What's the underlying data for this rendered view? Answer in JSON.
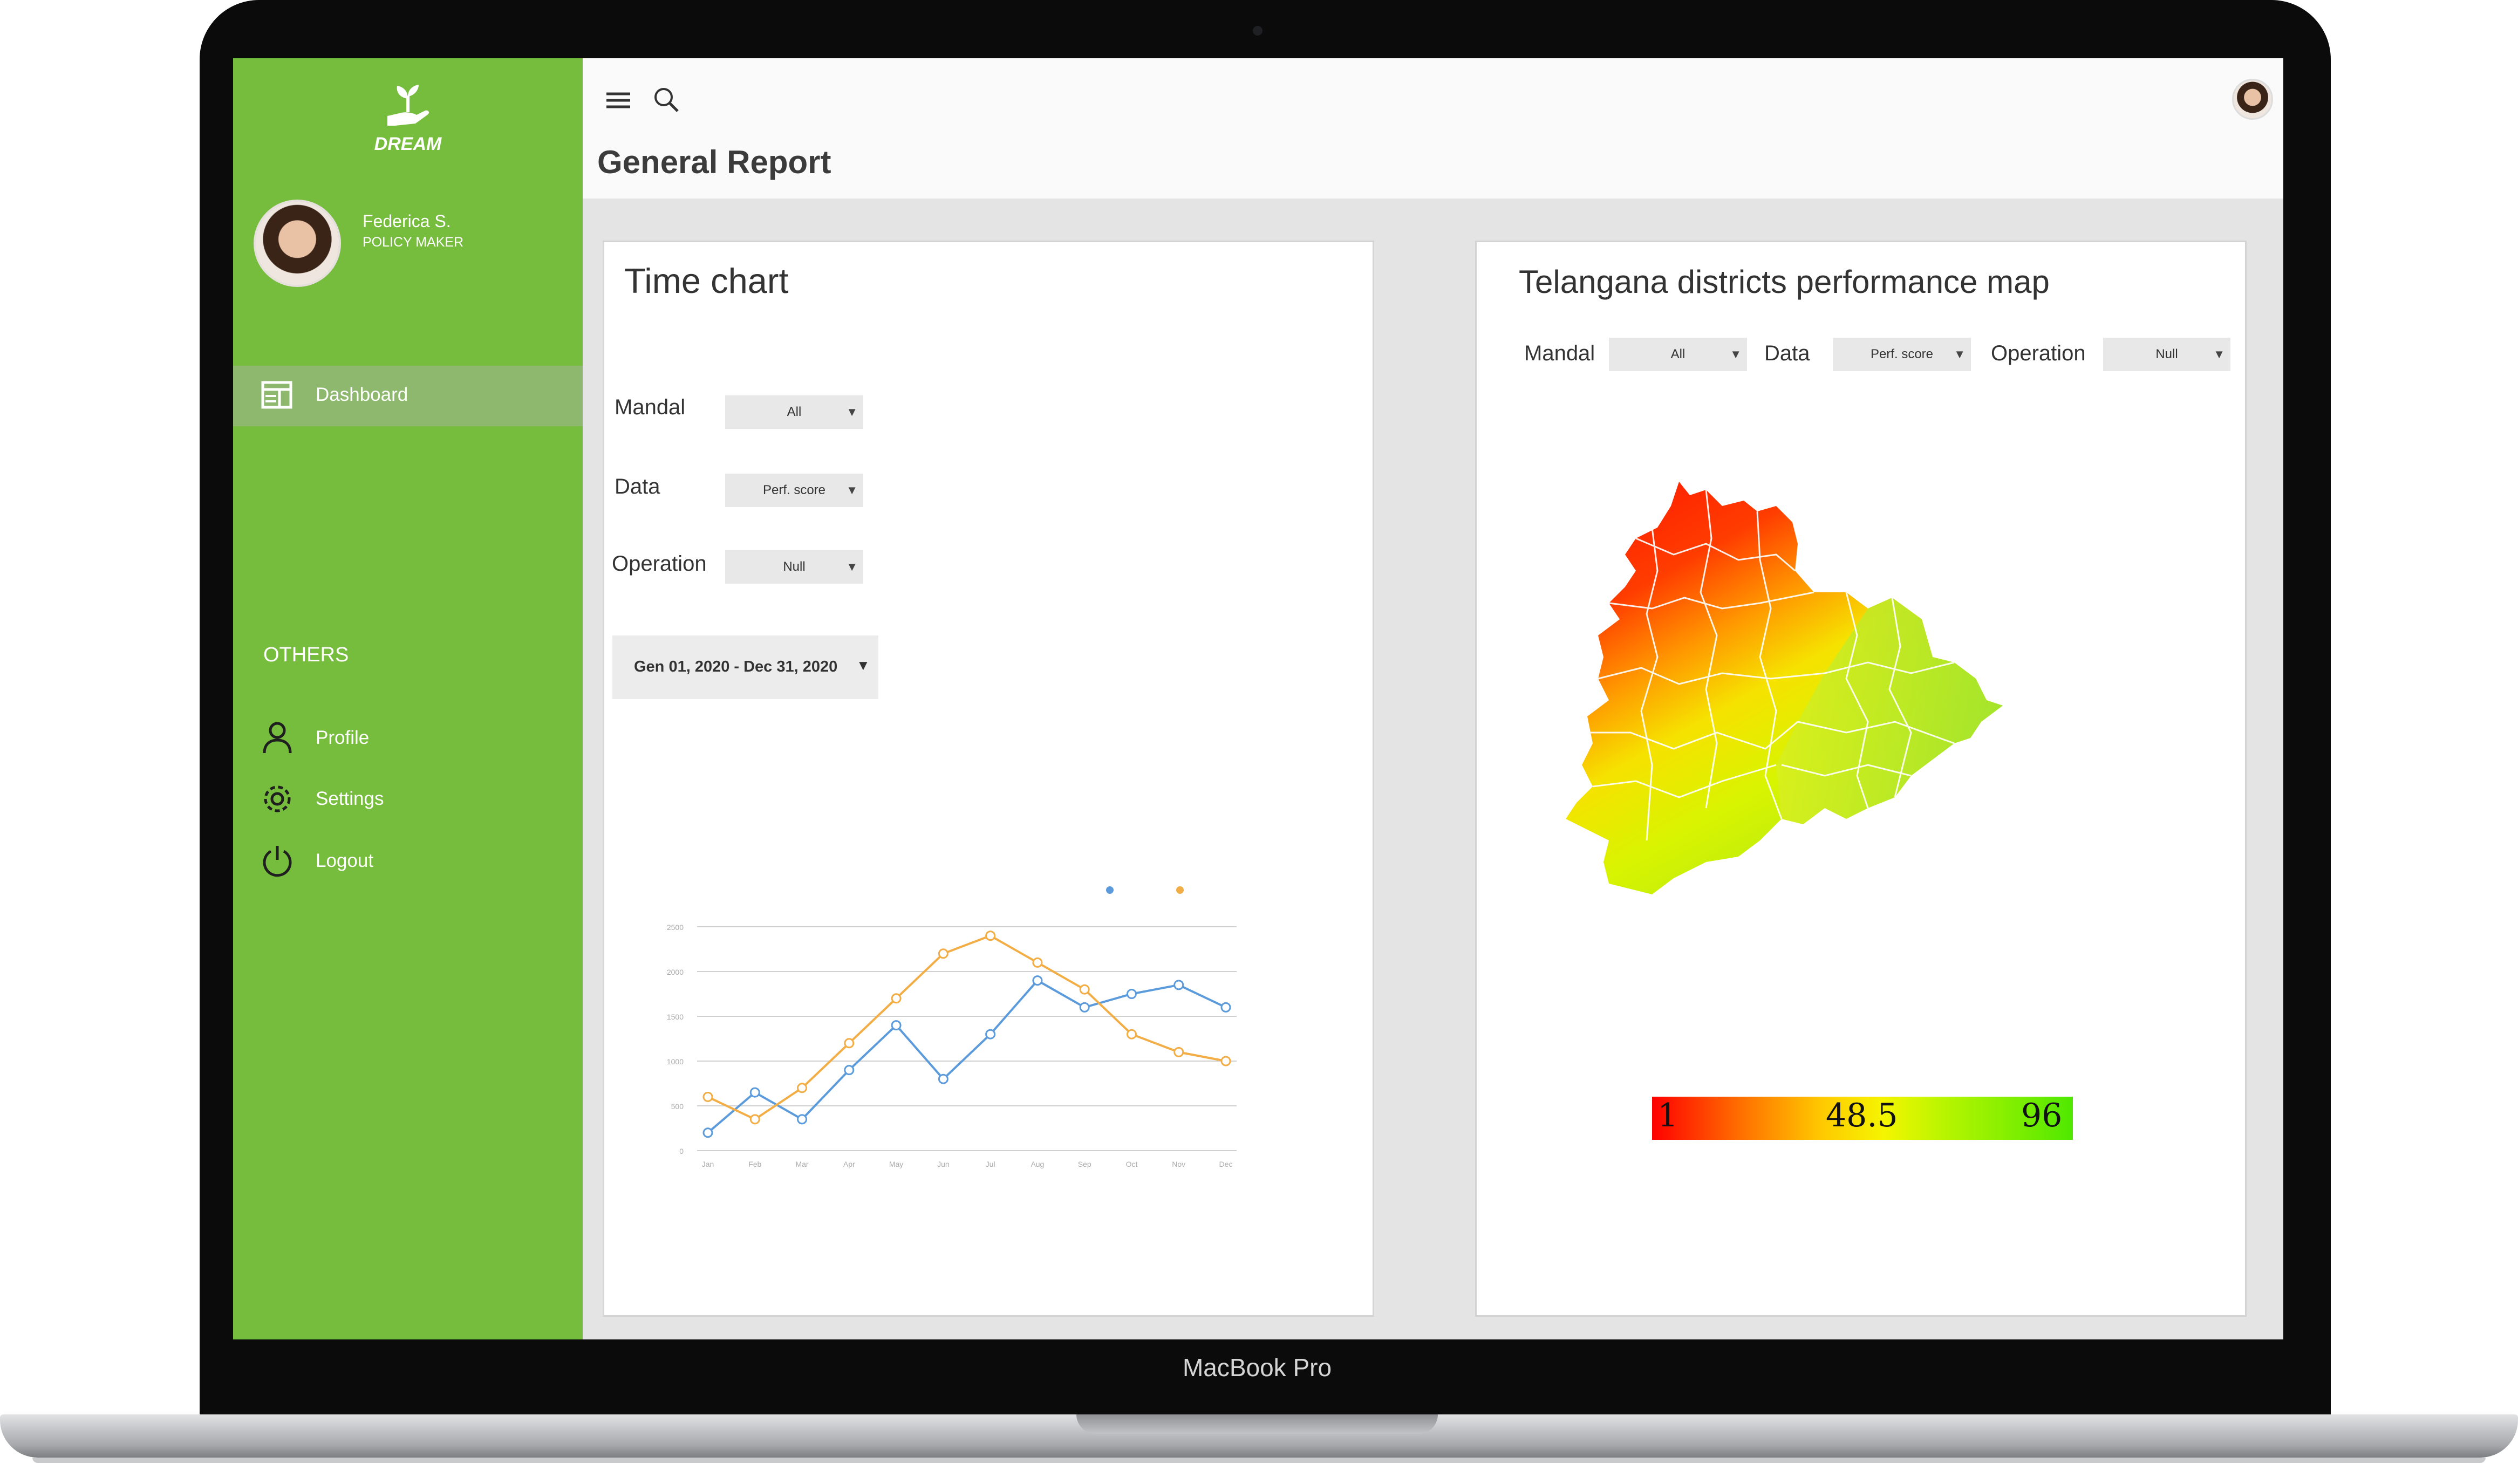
{
  "device_label": "MacBook Pro",
  "sidebar": {
    "logo_text": "DREAM",
    "user": {
      "name": "Federica S.",
      "role": "POLICY MAKER"
    },
    "nav": [
      {
        "label": "Dashboard",
        "icon": "dashboard-icon",
        "active": true
      }
    ],
    "section_label": "OTHERS",
    "others": [
      {
        "label": "Profile",
        "icon": "user-icon"
      },
      {
        "label": "Settings",
        "icon": "gear-icon"
      },
      {
        "label": "Logout",
        "icon": "power-icon"
      }
    ],
    "colors": {
      "background": "#76bc3d",
      "active_item": "#8db86d"
    }
  },
  "header": {
    "title": "General Report",
    "icons": [
      "menu-icon",
      "search-icon"
    ]
  },
  "time_chart": {
    "title": "Time chart",
    "filters": [
      {
        "label": "Mandal",
        "value": "All"
      },
      {
        "label": "Data",
        "value": "Perf. score"
      },
      {
        "label": "Operation",
        "value": "Null"
      }
    ],
    "date_range": "Gen 01, 2020 - Dec 31, 2020"
  },
  "chart_data": {
    "type": "line",
    "categories": [
      "Jan",
      "Feb",
      "Mar",
      "Apr",
      "May",
      "Jun",
      "Jul",
      "Aug",
      "Sep",
      "Oct",
      "Nov",
      "Dec"
    ],
    "series": [
      {
        "color": "#5b9bdc",
        "values": [
          200,
          650,
          350,
          900,
          1400,
          800,
          1300,
          1900,
          1600,
          1750,
          1850,
          1600
        ]
      },
      {
        "color": "#f3ad45",
        "values": [
          600,
          350,
          700,
          1200,
          1700,
          2200,
          2400,
          2100,
          1800,
          1300,
          1100,
          1000
        ]
      }
    ],
    "yticks": [
      "0",
      "500",
      "1000",
      "1500",
      "2000",
      "2500"
    ],
    "ylim": [
      0,
      2500
    ],
    "grid": true,
    "legend": "top-right"
  },
  "map": {
    "title": "Telangana districts performance map",
    "filters": [
      {
        "label": "Mandal",
        "value": "All"
      },
      {
        "label": "Data",
        "value": "Perf. score"
      },
      {
        "label": "Operation",
        "value": "Null"
      }
    ],
    "scale": {
      "min": "1",
      "mid": "48.5",
      "max": "96"
    },
    "colors": {
      "low": "#ff0000",
      "mid": "#f5f500",
      "high": "#50e800"
    }
  }
}
